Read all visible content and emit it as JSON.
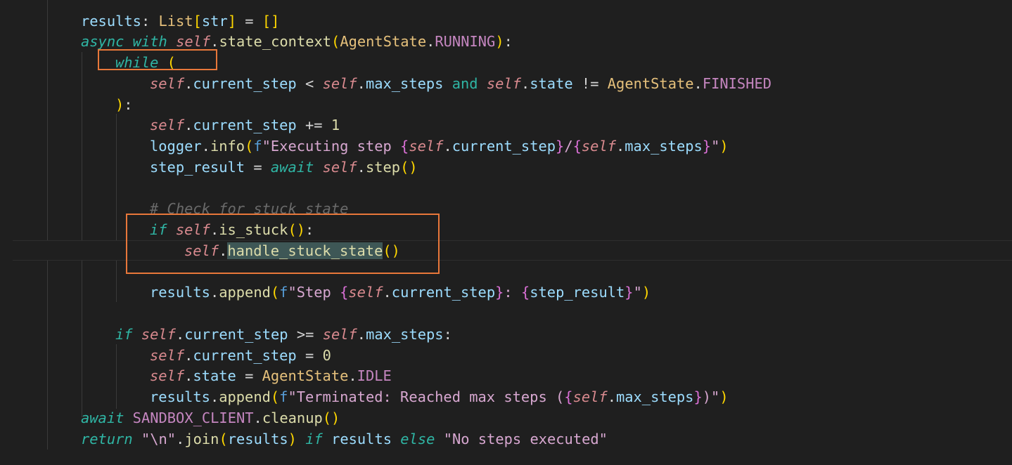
{
  "code_lines": [
    "results: List[str] = []",
    "async with self.state_context(AgentState.RUNNING):",
    "while (",
    "self.current_step < self.max_steps and self.state != AgentState.FINISHED",
    "):",
    "self.current_step += 1",
    "logger.info(f\"Executing step {self.current_step}/{self.max_steps}\")",
    "step_result = await self.step()",
    "",
    "# Check for stuck state",
    "if self.is_stuck():",
    "self.handle_stuck_state()",
    "",
    "results.append(f\"Step {self.current_step}: {step_result}\")",
    "",
    "if self.current_step >= self.max_steps:",
    "self.current_step = 0",
    "self.state = AgentState.IDLE",
    "results.append(f\"Terminated: Reached max steps ({self.max_steps})\")",
    "await SANDBOX_CLIENT.cleanup()",
    "return \"\\n\".join(results) if results else \"No steps executed\""
  ],
  "selection": "handle_stuck_state",
  "highlight_boxes": [
    "while-loop-box",
    "stuck-check-box"
  ],
  "theme": {
    "background": "#1f1f1f",
    "box_color": "#e8773a",
    "selection_color": "#3e5756"
  }
}
